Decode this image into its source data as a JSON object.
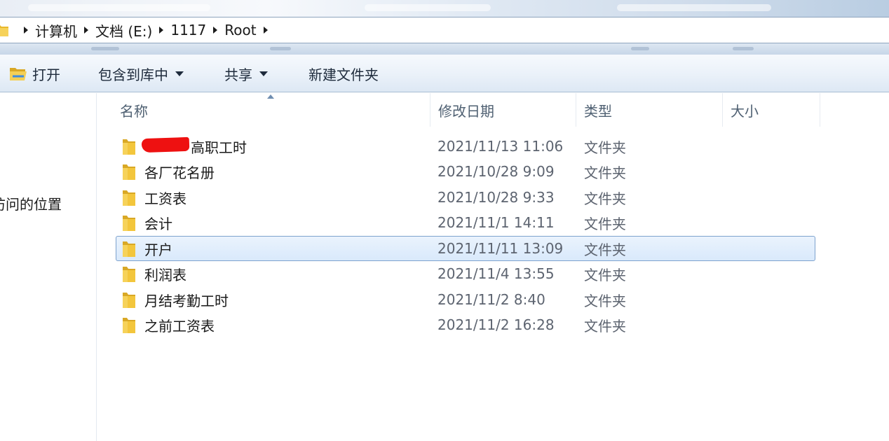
{
  "address_bar": {
    "crumbs": [
      "计算机",
      "文档 (E:)",
      "1117",
      "Root"
    ]
  },
  "toolbar": {
    "open_label": "打开",
    "include_label": "包含到库中",
    "share_label": "共享",
    "new_folder_label": "新建文件夹"
  },
  "nav": {
    "recent_places_label": "访问的位置"
  },
  "columns": {
    "name": "名称",
    "modified": "修改日期",
    "type": "类型",
    "size": "大小"
  },
  "files": [
    {
      "name": "高职工时",
      "modified": "2021/11/13 11:06",
      "type": "文件夹",
      "redacted": true
    },
    {
      "name": "各厂花名册",
      "modified": "2021/10/28 9:09",
      "type": "文件夹"
    },
    {
      "name": "工资表",
      "modified": "2021/10/28 9:33",
      "type": "文件夹"
    },
    {
      "name": "会计",
      "modified": "2021/11/1 14:11",
      "type": "文件夹"
    },
    {
      "name": "开户",
      "modified": "2021/11/11 13:09",
      "type": "文件夹",
      "selected": true
    },
    {
      "name": "利润表",
      "modified": "2021/11/4 13:55",
      "type": "文件夹"
    },
    {
      "name": "月结考勤工时",
      "modified": "2021/11/2 8:40",
      "type": "文件夹"
    },
    {
      "name": "之前工资表",
      "modified": "2021/11/2 16:28",
      "type": "文件夹"
    }
  ],
  "icons": {
    "folder": "folder-icon",
    "open": "open-folder-icon",
    "breadcrumb_separator": "chevron-right-icon",
    "dropdown": "chevron-down-icon",
    "sort": "sort-ascending-icon"
  },
  "colors": {
    "selection_fill": "#d9e9fb",
    "selection_border": "#7da2ce",
    "folder": "#f3c63c",
    "redaction": "#ee1111"
  }
}
